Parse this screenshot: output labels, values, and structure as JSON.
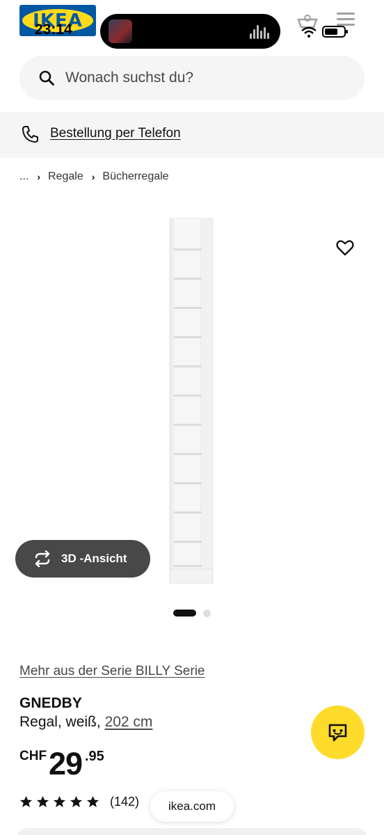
{
  "status_bar": {
    "time": "23:14",
    "logo_text": "IKEA"
  },
  "search": {
    "placeholder": "Wonach suchst du?"
  },
  "phone_order": {
    "label": "Bestellung per Telefon"
  },
  "breadcrumb": {
    "ellipsis": "...",
    "items": [
      "Regale",
      "Bücherregale"
    ]
  },
  "gallery": {
    "view_3d_label": "3D -Ansicht",
    "image_count": 2,
    "active_index": 0
  },
  "product": {
    "series_link": "Mehr aus der Serie BILLY Serie",
    "name": "GNEDBY",
    "description": "Regal, weiß,",
    "size": "202 cm",
    "currency": "CHF",
    "price_int": "29",
    "price_dec": ".95",
    "rating": 5,
    "review_count": "(142)"
  },
  "browser": {
    "url": "ikea.com"
  },
  "colors": {
    "brand_blue": "#0058a3",
    "brand_yellow": "#ffdb2b",
    "button_dark": "#484848"
  },
  "icons": [
    "search-icon",
    "phone-icon",
    "heart-icon",
    "rotate-icon",
    "chat-icon",
    "star-icon",
    "basket-icon",
    "menu-icon"
  ]
}
